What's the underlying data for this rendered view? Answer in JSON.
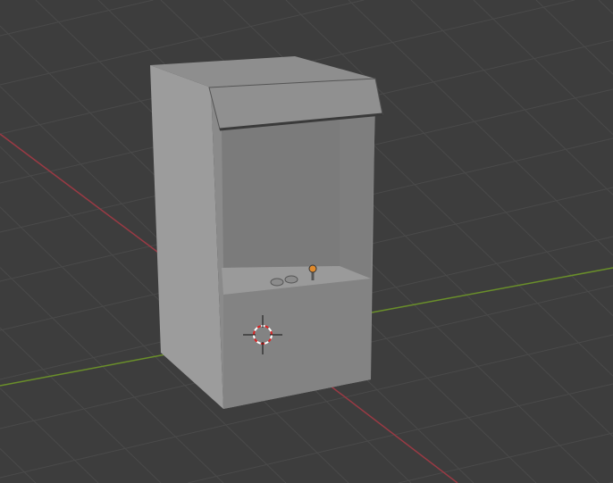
{
  "viewport": {
    "background_color": "#3d3d3d",
    "grid_color": "#4a4a4a",
    "x_axis_color": "#9a3a44",
    "y_axis_color": "#6a8f2a"
  },
  "scene": {
    "object": "arcade-cabinet",
    "cursor": "3d-cursor"
  }
}
